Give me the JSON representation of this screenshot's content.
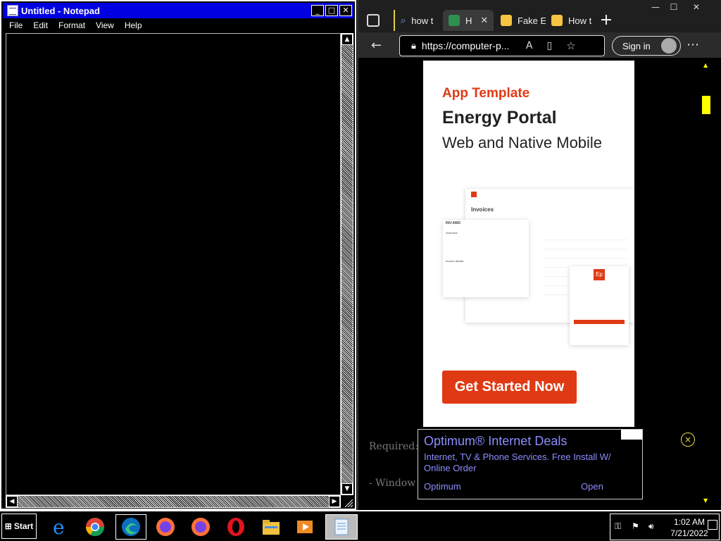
{
  "notepad": {
    "title": "Untitled - Notepad",
    "menu": [
      "File",
      "Edit",
      "Format",
      "View",
      "Help"
    ],
    "content": ""
  },
  "browser": {
    "window_controls": {
      "minimize": "—",
      "maximize": "☐",
      "close": "✕"
    },
    "tabs": [
      {
        "label": "how t",
        "icon": "search-icon",
        "active": false
      },
      {
        "label": "H",
        "icon": "site-favicon-green",
        "active": true
      },
      {
        "label": "Fake E",
        "icon": "emoji-favicon",
        "active": false
      },
      {
        "label": "How t",
        "icon": "emoji-favicon",
        "active": false
      }
    ],
    "new_tab": "+",
    "url": "https://computer-p...",
    "signin": "Sign in",
    "page": {
      "ad_card": {
        "kicker": "App Template",
        "headline": "Energy Portal",
        "subheadline": "Web and Native Mobile",
        "mock_invoices_title": "Invoices",
        "mock_invoice_id": "INV-9465",
        "mock_overview": "Overview",
        "mock_invoice_details": "Invoice details",
        "mock_login_logo": "Ep",
        "cta": "Get Started Now"
      },
      "text_line1": "Required:",
      "text_line2": "- Window"
    },
    "bottom_ad": {
      "title": "Optimum® Internet Deals",
      "description": "Internet, TV & Phone Services. Free Install W/ Online Order",
      "advertiser": "Optimum",
      "open": "Open"
    },
    "close_ad": "×"
  },
  "taskbar": {
    "start": "Start",
    "clock_time": "1:02 AM",
    "clock_date": "7/21/2022",
    "apps": [
      "internet-explorer-icon",
      "chrome-icon",
      "edge-icon",
      "firefox-icon",
      "firefox-icon",
      "opera-icon",
      "file-explorer-icon",
      "media-player-icon",
      "notepad-icon"
    ]
  },
  "colors": {
    "titlebar": "#0000e0",
    "accent_orange": "#e03a14",
    "ad_link": "#8d8dff",
    "scroll_yellow": "#ffff00"
  }
}
